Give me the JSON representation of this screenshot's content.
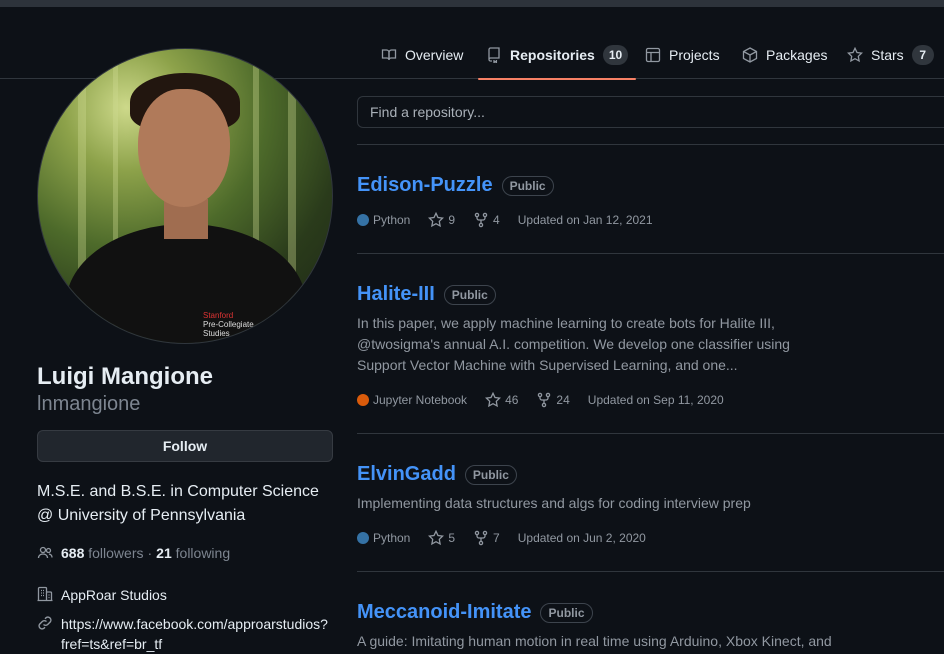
{
  "nav": {
    "tabs": [
      {
        "label": "Overview",
        "icon": "book-icon"
      },
      {
        "label": "Repositories",
        "icon": "repo-icon",
        "count": "10",
        "active": true
      },
      {
        "label": "Projects",
        "icon": "table-icon"
      },
      {
        "label": "Packages",
        "icon": "package-icon"
      },
      {
        "label": "Stars",
        "icon": "star-icon",
        "count": "7"
      }
    ]
  },
  "profile": {
    "name": "Luigi Mangione",
    "login": "lnmangione",
    "follow_label": "Follow",
    "bio": "M.S.E. and B.S.E. in Computer Science @ University of Pennsylvania",
    "followers_count": "688",
    "followers_label": "followers",
    "dot": "·",
    "following_count": "21",
    "following_label": "following",
    "company": "AppRoar Studios",
    "website_line1": "https://www.facebook.com/approarstudios?",
    "website_line2": "fref=ts&ref=br_tf",
    "avatar_text_1": "Stanford",
    "avatar_text_2": "Pre-Collegiate",
    "avatar_text_3": "Studies"
  },
  "search": {
    "placeholder": "Find a repository..."
  },
  "repos": [
    {
      "name": "Edison-Puzzle",
      "visibility": "Public",
      "description": "",
      "language": "Python",
      "lang_color": "#3572A5",
      "stars": "9",
      "forks": "4",
      "updated": "Updated on Jan 12, 2021"
    },
    {
      "name": "Halite-III",
      "visibility": "Public",
      "description": "In this paper, we apply machine learning to create bots for Halite III, @twosigma's annual A.I. competition. We develop one classifier using Support Vector Machine with Supervised Learning, and one...",
      "language": "Jupyter Notebook",
      "lang_color": "#DA5B0B",
      "stars": "46",
      "forks": "24",
      "updated": "Updated on Sep 11, 2020"
    },
    {
      "name": "ElvinGadd",
      "visibility": "Public",
      "description": "Implementing data structures and algs for coding interview prep",
      "language": "Python",
      "lang_color": "#3572A5",
      "stars": "5",
      "forks": "7",
      "updated": "Updated on Jun 2, 2020"
    },
    {
      "name": "Meccanoid-Imitate",
      "visibility": "Public",
      "description": "A guide: Imitating human motion in real time using Arduino, Xbox Kinect, and",
      "language": "",
      "lang_color": "",
      "stars": "",
      "forks": "",
      "updated": ""
    }
  ],
  "colors": {
    "accent": "#f78166",
    "link": "#4493f8",
    "muted": "#9198a1"
  }
}
